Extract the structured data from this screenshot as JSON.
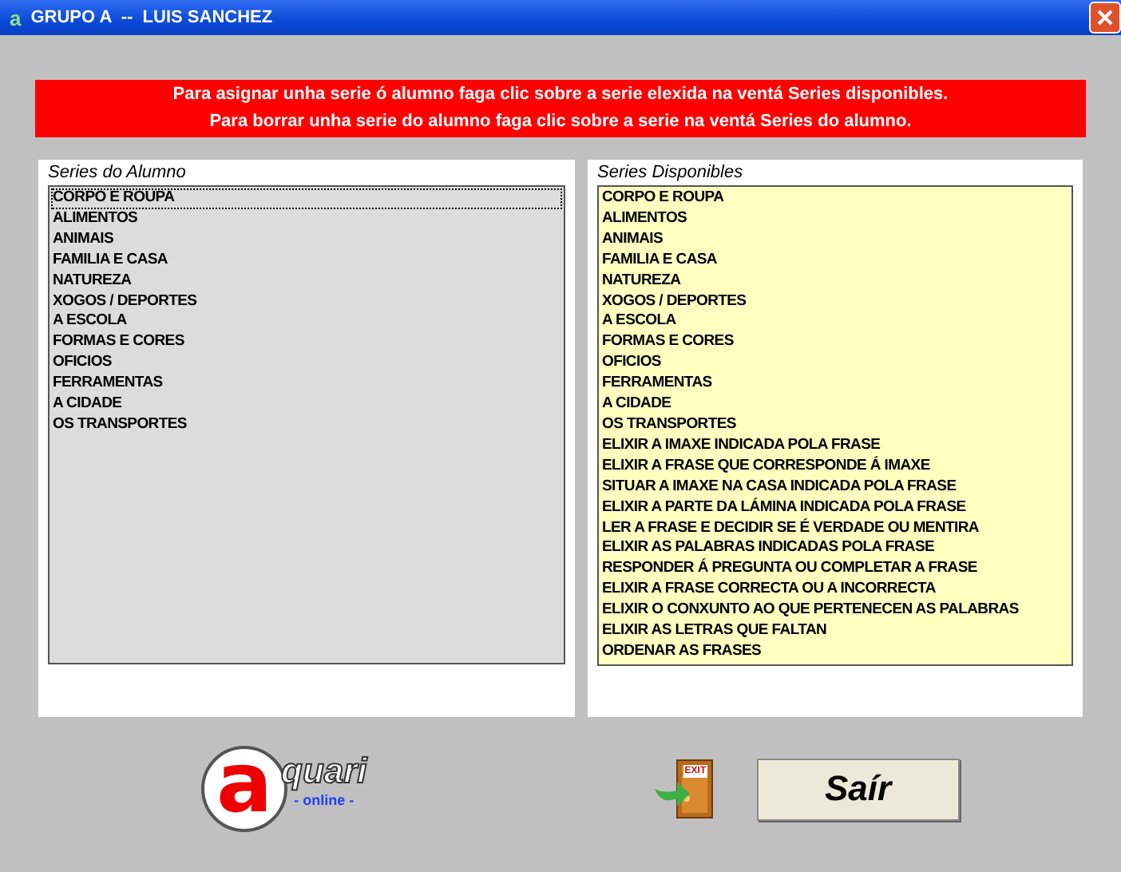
{
  "window": {
    "title": "GRUPO A  --  LUIS SANCHEZ",
    "app_icon": "a"
  },
  "instructions": [
    "Para asignar unha serie ó alumno faga clic sobre a serie elexida na ventá Series disponibles.",
    "Para borrar unha serie do alumno faga clic sobre a serie na ventá Series do alumno."
  ],
  "student_series": {
    "title": "Series do Alumno",
    "items": [
      {
        "label": "CORPO E ROUPA",
        "selected": true
      },
      {
        "label": "ALIMENTOS",
        "selected": false
      },
      {
        "label": "ANIMAIS",
        "selected": false
      },
      {
        "label": "FAMILIA E CASA",
        "selected": false
      },
      {
        "label": "NATUREZA",
        "selected": false
      },
      {
        "label": "XOGOS / DEPORTES",
        "selected": false
      },
      {
        "label": "A ESCOLA",
        "selected": false
      },
      {
        "label": "FORMAS E CORES",
        "selected": false
      },
      {
        "label": "OFICIOS",
        "selected": false
      },
      {
        "label": "FERRAMENTAS",
        "selected": false
      },
      {
        "label": "A CIDADE",
        "selected": false
      },
      {
        "label": "OS TRANSPORTES",
        "selected": false
      }
    ]
  },
  "available_series": {
    "title": "Series Disponibles",
    "items": [
      {
        "label": "CORPO E ROUPA",
        "selected": false
      },
      {
        "label": "ALIMENTOS",
        "selected": false
      },
      {
        "label": "ANIMAIS",
        "selected": false
      },
      {
        "label": "FAMILIA E CASA",
        "selected": false
      },
      {
        "label": "NATUREZA",
        "selected": false
      },
      {
        "label": "XOGOS / DEPORTES",
        "selected": false
      },
      {
        "label": "A ESCOLA",
        "selected": false
      },
      {
        "label": "FORMAS E CORES",
        "selected": false
      },
      {
        "label": "OFICIOS",
        "selected": false
      },
      {
        "label": "FERRAMENTAS",
        "selected": false
      },
      {
        "label": "A CIDADE",
        "selected": false
      },
      {
        "label": "OS TRANSPORTES",
        "selected": false
      },
      {
        "label": "ELIXIR A IMAXE INDICADA POLA FRASE",
        "selected": false
      },
      {
        "label": "ELIXIR A FRASE QUE CORRESPONDE Á IMAXE",
        "selected": false
      },
      {
        "label": "SITUAR A IMAXE NA CASA INDICADA POLA FRASE",
        "selected": false
      },
      {
        "label": "ELIXIR A PARTE DA LÁMINA INDICADA POLA FRASE",
        "selected": false
      },
      {
        "label": "LER A FRASE E DECIDIR SE É VERDADE OU MENTIRA",
        "selected": false
      },
      {
        "label": "ELIXIR AS PALABRAS INDICADAS POLA FRASE",
        "selected": false
      },
      {
        "label": "RESPONDER Á PREGUNTA OU COMPLETAR A FRASE",
        "selected": false
      },
      {
        "label": "ELIXIR A FRASE CORRECTA OU A INCORRECTA",
        "selected": false
      },
      {
        "label": "ELIXIR O CONXUNTO AO QUE PERTENECEN AS PALABRAS",
        "selected": false
      },
      {
        "label": "ELIXIR AS LETRAS QUE FALTAN",
        "selected": false
      },
      {
        "label": "ORDENAR AS FRASES",
        "selected": false
      }
    ]
  },
  "logo": {
    "letter": "a",
    "word": "quari",
    "tagline": "- online -"
  },
  "exit_icon_text": "EXIT",
  "buttons": [
    "Saír"
  ]
}
